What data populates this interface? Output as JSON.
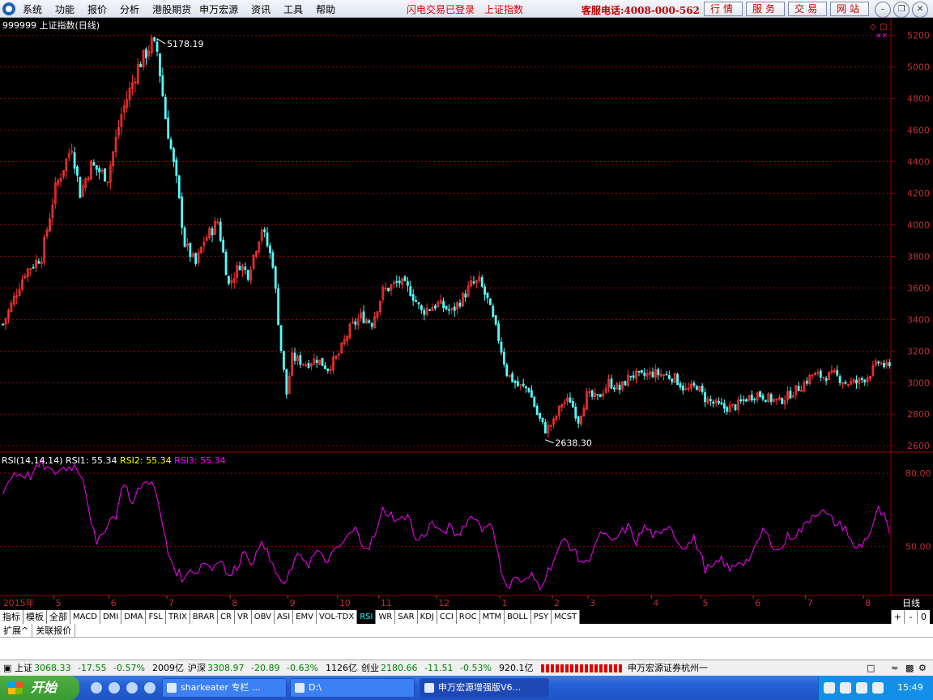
{
  "menubar": {
    "items": [
      "系统",
      "功能",
      "报价",
      "分析",
      "港股期货",
      "申万宏源",
      "资讯",
      "工具",
      "帮助"
    ],
    "login_status": "闪电交易已登录",
    "index_name": "上证指数",
    "hotline": "客服电话:4008-000-562",
    "buttons": [
      "行情",
      "服务",
      "交易",
      "网站"
    ]
  },
  "colors": {
    "up": "#ff3232",
    "down": "#54ffff",
    "rsi_line": "#ff00ff",
    "grid": "#a00000",
    "axis_text": "#c03030"
  },
  "chart_data": [
    {
      "type": "candlestick",
      "title": "999999 上证指数(日线)",
      "ylim": [
        2560,
        5260
      ],
      "y_ticks": [
        2600,
        2800,
        3000,
        3200,
        3400,
        3600,
        3800,
        4000,
        4200,
        4400,
        4600,
        4800,
        5000,
        5200
      ],
      "annotations": [
        {
          "label": "5178.19",
          "value": 5178.19
        },
        {
          "label": "2638.30",
          "value": 2638.3
        }
      ],
      "months": [
        {
          "label": "2015年",
          "day": 0
        },
        {
          "label": "5",
          "day": 20
        },
        {
          "label": "6",
          "day": 40
        },
        {
          "label": "7",
          "day": 61
        },
        {
          "label": "8",
          "day": 84
        },
        {
          "label": "9",
          "day": 105
        },
        {
          "label": "10",
          "day": 123
        },
        {
          "label": "11",
          "day": 138
        },
        {
          "label": "12",
          "day": 159
        },
        {
          "label": "1",
          "day": 182
        },
        {
          "label": "2",
          "day": 201
        },
        {
          "label": "3",
          "day": 214
        },
        {
          "label": "4",
          "day": 237
        },
        {
          "label": "5",
          "day": 255
        },
        {
          "label": "6",
          "day": 274
        },
        {
          "label": "7",
          "day": 293
        },
        {
          "label": "8",
          "day": 314
        }
      ],
      "anchors": [
        [
          0,
          3370
        ],
        [
          8,
          3700
        ],
        [
          14,
          3800
        ],
        [
          19,
          4230
        ],
        [
          25,
          4500
        ],
        [
          28,
          4200
        ],
        [
          32,
          4380
        ],
        [
          38,
          4300
        ],
        [
          43,
          4700
        ],
        [
          49,
          5000
        ],
        [
          54,
          5150
        ],
        [
          56,
          5100
        ],
        [
          59,
          4680
        ],
        [
          63,
          4280
        ],
        [
          66,
          3880
        ],
        [
          70,
          3750
        ],
        [
          73,
          3900
        ],
        [
          78,
          4020
        ],
        [
          82,
          3620
        ],
        [
          86,
          3750
        ],
        [
          89,
          3690
        ],
        [
          94,
          3980
        ],
        [
          98,
          3760
        ],
        [
          101,
          3210
        ],
        [
          103,
          2930
        ],
        [
          105,
          3160
        ],
        [
          110,
          3120
        ],
        [
          114,
          3150
        ],
        [
          118,
          3090
        ],
        [
          122,
          3180
        ],
        [
          126,
          3340
        ],
        [
          130,
          3420
        ],
        [
          134,
          3380
        ],
        [
          138,
          3580
        ],
        [
          144,
          3640
        ],
        [
          148,
          3580
        ],
        [
          152,
          3450
        ],
        [
          158,
          3500
        ],
        [
          163,
          3450
        ],
        [
          167,
          3540
        ],
        [
          170,
          3620
        ],
        [
          173,
          3640
        ],
        [
          176,
          3520
        ],
        [
          180,
          3280
        ],
        [
          183,
          3060
        ],
        [
          187,
          2980
        ],
        [
          191,
          2960
        ],
        [
          194,
          2800
        ],
        [
          197,
          2700
        ],
        [
          200,
          2750
        ],
        [
          203,
          2870
        ],
        [
          206,
          2890
        ],
        [
          209,
          2760
        ],
        [
          212,
          2920
        ],
        [
          216,
          2900
        ],
        [
          220,
          3000
        ],
        [
          224,
          2960
        ],
        [
          228,
          3050
        ],
        [
          232,
          3040
        ],
        [
          236,
          3060
        ],
        [
          240,
          3050
        ],
        [
          244,
          3030
        ],
        [
          248,
          2950
        ],
        [
          252,
          2980
        ],
        [
          255,
          2900
        ],
        [
          258,
          2870
        ],
        [
          262,
          2840
        ],
        [
          266,
          2850
        ],
        [
          270,
          2900
        ],
        [
          274,
          2930
        ],
        [
          278,
          2900
        ],
        [
          282,
          2880
        ],
        [
          286,
          2930
        ],
        [
          290,
          2980
        ],
        [
          294,
          3050
        ],
        [
          298,
          3040
        ],
        [
          302,
          3050
        ],
        [
          306,
          3000
        ],
        [
          310,
          3000
        ],
        [
          314,
          3040
        ],
        [
          318,
          3130
        ],
        [
          322,
          3090
        ]
      ]
    },
    {
      "type": "line",
      "title": "RSI(14,14,14)",
      "series_labels": [
        {
          "label": "RSI1: 55.34",
          "color": "#ffffff"
        },
        {
          "label": "RSI2: 55.34",
          "color": "#ffff00"
        },
        {
          "label": "RSI3: 55.34",
          "color": "#ff00ff"
        }
      ],
      "ylim": [
        30,
        88
      ],
      "y_ticks": [
        "80.00",
        "50.00"
      ],
      "anchors": [
        [
          0,
          73
        ],
        [
          4,
          80
        ],
        [
          10,
          79
        ],
        [
          14,
          84
        ],
        [
          18,
          80
        ],
        [
          22,
          82
        ],
        [
          26,
          83
        ],
        [
          29,
          79
        ],
        [
          32,
          61
        ],
        [
          34,
          50
        ],
        [
          38,
          60
        ],
        [
          41,
          63
        ],
        [
          44,
          77
        ],
        [
          47,
          67
        ],
        [
          50,
          75
        ],
        [
          52,
          76
        ],
        [
          54,
          78
        ],
        [
          57,
          64
        ],
        [
          60,
          47
        ],
        [
          63,
          40
        ],
        [
          66,
          36
        ],
        [
          68,
          42
        ],
        [
          70,
          39
        ],
        [
          73,
          44
        ],
        [
          76,
          41
        ],
        [
          79,
          46
        ],
        [
          82,
          37
        ],
        [
          85,
          42
        ],
        [
          88,
          49
        ],
        [
          91,
          42
        ],
        [
          94,
          54
        ],
        [
          97,
          44
        ],
        [
          100,
          38
        ],
        [
          102,
          33
        ],
        [
          105,
          42
        ],
        [
          108,
          47
        ],
        [
          111,
          43
        ],
        [
          114,
          48
        ],
        [
          117,
          44
        ],
        [
          120,
          47
        ],
        [
          123,
          51
        ],
        [
          126,
          55
        ],
        [
          128,
          57
        ],
        [
          130,
          52
        ],
        [
          133,
          50
        ],
        [
          136,
          57
        ],
        [
          138,
          65
        ],
        [
          141,
          63
        ],
        [
          144,
          60
        ],
        [
          147,
          64
        ],
        [
          150,
          52
        ],
        [
          153,
          55
        ],
        [
          156,
          60
        ],
        [
          159,
          55
        ],
        [
          162,
          58
        ],
        [
          165,
          54
        ],
        [
          168,
          60
        ],
        [
          171,
          63
        ],
        [
          174,
          57
        ],
        [
          177,
          61
        ],
        [
          180,
          45
        ],
        [
          182,
          37
        ],
        [
          184,
          33
        ],
        [
          186,
          38
        ],
        [
          189,
          35
        ],
        [
          192,
          38
        ],
        [
          195,
          34
        ],
        [
          198,
          40
        ],
        [
          201,
          47
        ],
        [
          204,
          53
        ],
        [
          207,
          49
        ],
        [
          209,
          45
        ],
        [
          212,
          43
        ],
        [
          215,
          51
        ],
        [
          218,
          56
        ],
        [
          221,
          51
        ],
        [
          224,
          55
        ],
        [
          227,
          58
        ],
        [
          230,
          52
        ],
        [
          233,
          58
        ],
        [
          236,
          55
        ],
        [
          239,
          54
        ],
        [
          242,
          60
        ],
        [
          245,
          52
        ],
        [
          248,
          50
        ],
        [
          251,
          53
        ],
        [
          253,
          48
        ],
        [
          255,
          41
        ],
        [
          258,
          41
        ],
        [
          261,
          45
        ],
        [
          264,
          40
        ],
        [
          267,
          44
        ],
        [
          270,
          44
        ],
        [
          273,
          48
        ],
        [
          276,
          57
        ],
        [
          279,
          52
        ],
        [
          282,
          48
        ],
        [
          285,
          54
        ],
        [
          288,
          55
        ],
        [
          291,
          58
        ],
        [
          294,
          63
        ],
        [
          297,
          65
        ],
        [
          300,
          62
        ],
        [
          303,
          59
        ],
        [
          306,
          58
        ],
        [
          309,
          49
        ],
        [
          312,
          51
        ],
        [
          315,
          56
        ],
        [
          318,
          65
        ],
        [
          320,
          62
        ],
        [
          322,
          55
        ]
      ]
    }
  ],
  "date_axis": {
    "right_label": "日线"
  },
  "indicator_tabs": [
    "指标",
    "模板",
    "全部",
    "MACD",
    "DMI",
    "DMA",
    "FSL",
    "TRIX",
    "BRAR",
    "CR",
    "VR",
    "OBV",
    "ASI",
    "EMV",
    "VOL-TDX",
    "RSI",
    "WR",
    "SAR",
    "KDJ",
    "CCI",
    "ROC",
    "MTM",
    "BOLL",
    "PSY",
    "MCST"
  ],
  "active_tab": "RSI",
  "period_controls": [
    "+",
    "-",
    "0"
  ],
  "sub_tabs": [
    "扩展^",
    "关联报价"
  ],
  "statusbar": {
    "sh_label": "上证",
    "sh_price": "3068.33",
    "sh_change": "-17.55",
    "sh_pct": "-0.57%",
    "sh_amount": "2009亿",
    "hs_label": "沪深",
    "hs_price": "3308.97",
    "hs_change": "-20.89",
    "hs_pct": "-0.63%",
    "hs_amount": "1126亿",
    "cy_label": "创业",
    "cy_price": "2180.66",
    "cy_change": "-11.51",
    "cy_pct": "-0.53%",
    "cy_amount": "920.1亿",
    "broker": "申万宏源证券杭州一"
  },
  "taskbar": {
    "start": "开始",
    "tasks": [
      "sharkeater 专栏 ...",
      "D:\\",
      "申万宏源增强版V6..."
    ],
    "clock": "15:49"
  }
}
